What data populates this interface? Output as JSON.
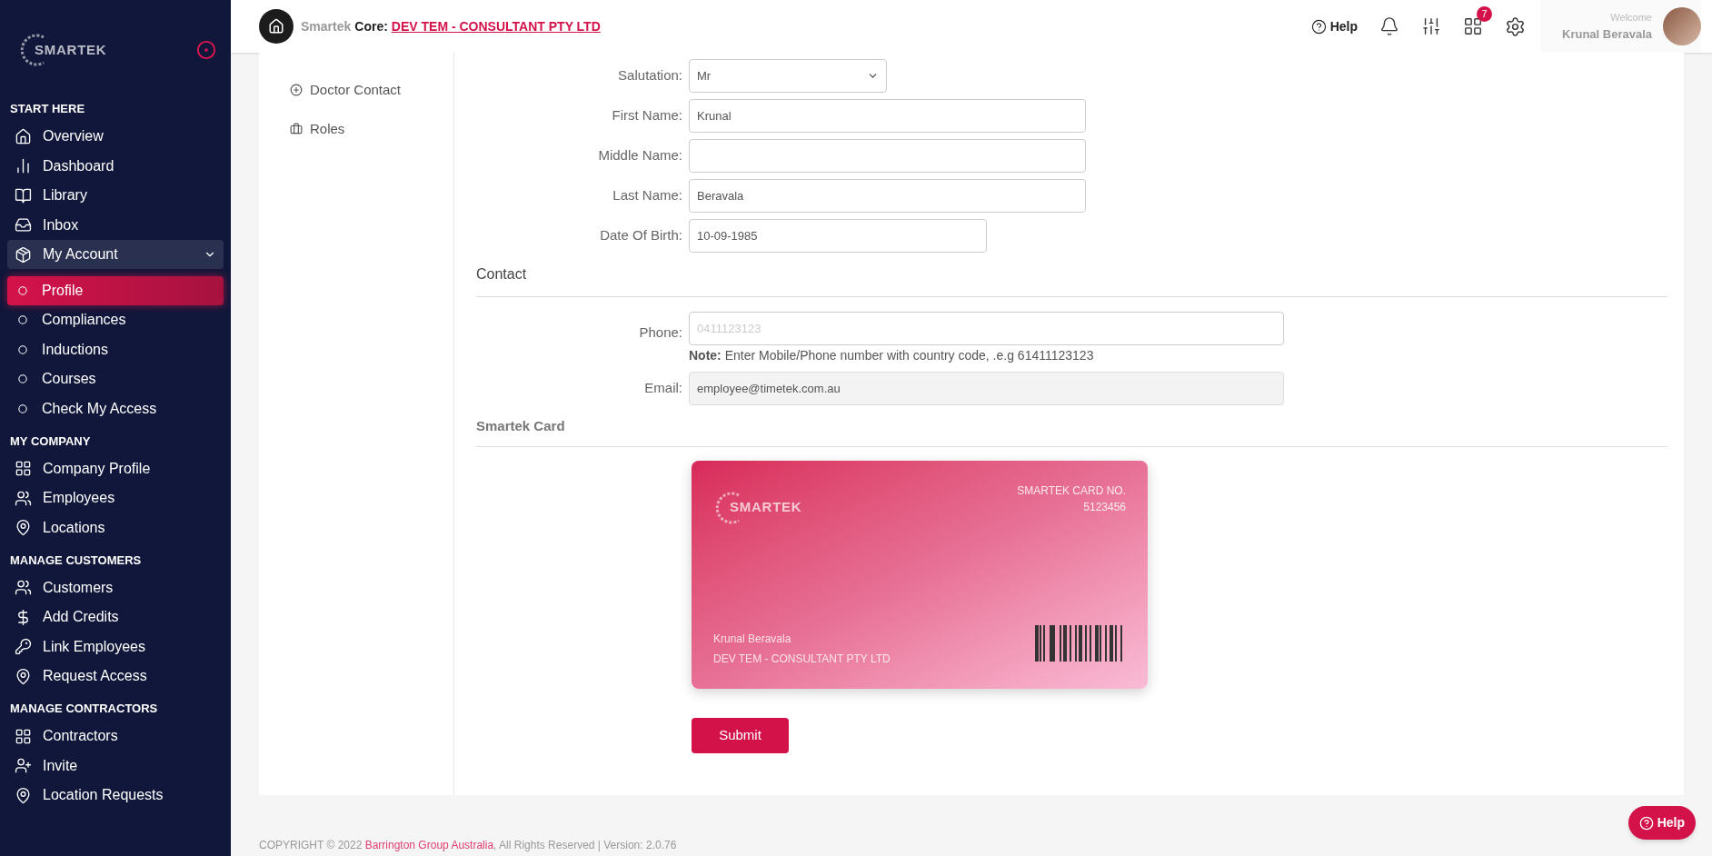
{
  "sidebar": {
    "logo": "SMARTEK",
    "sections": [
      {
        "title": "START HERE",
        "items": [
          {
            "label": "Overview",
            "selected": false
          },
          {
            "label": "Dashboard",
            "selected": false
          },
          {
            "label": "Library",
            "selected": false
          },
          {
            "label": "Inbox",
            "selected": false
          },
          {
            "label": "My Account",
            "selected": false,
            "expanded": true,
            "children": [
              {
                "label": "Profile",
                "selected": true
              },
              {
                "label": "Compliances",
                "selected": false
              },
              {
                "label": "Inductions",
                "selected": false
              },
              {
                "label": "Courses",
                "selected": false
              },
              {
                "label": "Check My Access",
                "selected": false
              }
            ]
          }
        ]
      },
      {
        "title": "MY COMPANY",
        "items": [
          {
            "label": "Company Profile",
            "selected": false
          },
          {
            "label": "Employees",
            "selected": false
          },
          {
            "label": "Locations",
            "selected": false
          }
        ]
      },
      {
        "title": "MANAGE CUSTOMERS",
        "items": [
          {
            "label": "Customers",
            "selected": false
          },
          {
            "label": "Add Credits",
            "selected": false
          },
          {
            "label": "Link Employees",
            "selected": false
          },
          {
            "label": "Request Access",
            "selected": false
          }
        ]
      },
      {
        "title": "MANAGE CONTRACTORS",
        "items": [
          {
            "label": "Contractors",
            "selected": false
          },
          {
            "label": "Invite",
            "selected": false
          },
          {
            "label": "Location Requests",
            "selected": false
          }
        ]
      }
    ]
  },
  "header": {
    "brand": "Smartek",
    "core_label": "Core:",
    "company_link": "DEV TEM - CONSULTANT PTY LTD",
    "help": "Help",
    "apps_badge": "7",
    "welcome": "Welcome",
    "user_name": "Krunal Beravala"
  },
  "profile_nav": [
    {
      "label": "Doctor Contact",
      "selected": false
    },
    {
      "label": "Roles",
      "selected": false
    }
  ],
  "form": {
    "salutation": {
      "label": "Salutation:",
      "value": "Mr"
    },
    "fields": [
      {
        "label": "First Name:",
        "value": "Krunal"
      },
      {
        "label": "Middle Name:"
      },
      {
        "label": "Last Name:",
        "value": "Beravala"
      },
      {
        "label": "Date Of Birth:",
        "value": "10-09-1985"
      }
    ],
    "contact_heading": "Contact",
    "phone": {
      "label": "Phone:",
      "placeholder": "0411123123",
      "note": "**Note:** Enter Mobile/Phone number with country code, .e.g 61411123123"
    },
    "email": {
      "label": "Email:",
      "value": "employee@timetek.com.au",
      "disabled": true
    },
    "card_heading": "Smartek Card",
    "card": {
      "logo": "SMARTEK",
      "number_label": "SMARTEK CARD NO.",
      "number": "5123456",
      "holder": "Krunal Beravala",
      "company": "DEV TEM - CONSULTANT PTY LTD"
    },
    "submit": "Submit"
  },
  "footer": {
    "copyright": "COPYRIGHT © 2022",
    "company": "Barrington Group Australia",
    "rest": ", All Rights Reserved | Version: 2.0.76"
  },
  "help_button": "Help"
}
